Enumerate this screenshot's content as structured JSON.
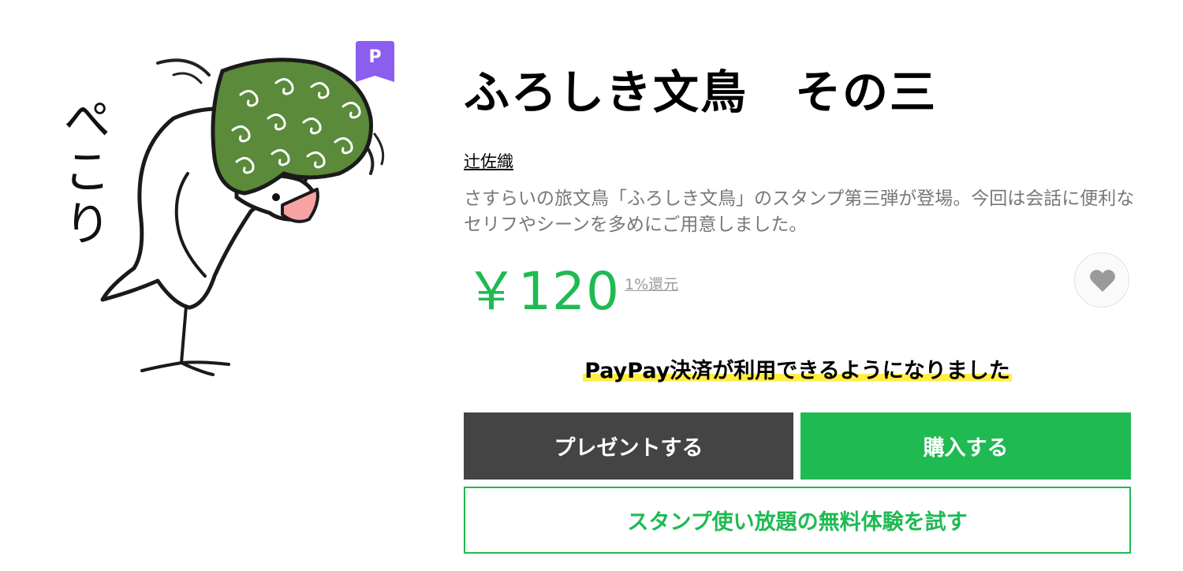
{
  "product": {
    "title": "ふろしき文鳥　その三",
    "author": "辻佐織",
    "description": "さすらいの旅文鳥「ふろしき文鳥」のスタンプ第三弾が登場。今回は会話に便利なセリフやシーンを多めにご用意しました。",
    "price": "￥120",
    "point_rate": "1%還元",
    "premium_badge": "P",
    "sticker_text": "ぺこり"
  },
  "notice": {
    "paypay": "PayPay決済が利用できるようになりました"
  },
  "actions": {
    "gift_label": "プレゼントする",
    "buy_label": "購入する",
    "trial_label": "スタンプ使い放題の無料体験を試す"
  },
  "colors": {
    "accent_green": "#1fba52",
    "gift_gray": "#444444",
    "premium_purple": "#8c5ef0",
    "highlight_yellow": "#ffee44",
    "furoshiki_green": "#5a8a3a"
  },
  "icons": {
    "favorite": "heart-icon",
    "premium": "premium-badge-icon"
  }
}
